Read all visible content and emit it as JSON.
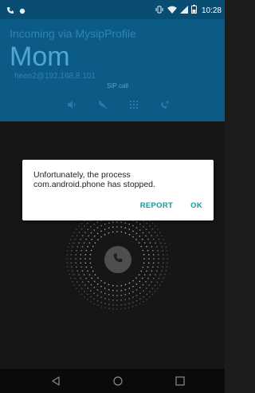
{
  "status_bar": {
    "time": "10:28",
    "left_icons": [
      "call-icon",
      "notification-dot-icon"
    ],
    "right_icons": [
      "vibrate-icon",
      "wifi-icon",
      "signal-icon",
      "battery-icon"
    ]
  },
  "call": {
    "incoming_label": "Incoming via MysipProfile",
    "caller_name": "Mom",
    "address": "heen2@192.168.8.101",
    "call_type": "SIP call"
  },
  "call_actions": [
    "speaker-icon",
    "mute-icon",
    "dialpad-icon",
    "add-call-icon"
  ],
  "dialog": {
    "message_line1": "Unfortunately, the process",
    "message_line2": "com.android.phone has stopped.",
    "report_label": "REPORT",
    "ok_label": "OK"
  },
  "nav_bar": {
    "buttons": [
      "back-icon",
      "home-icon",
      "recents-icon"
    ]
  },
  "colors": {
    "header_bg": "#0c5a86",
    "status_bar_bg": "#0a4d73",
    "dialog_accent": "#119c9c",
    "background": "#161616"
  }
}
